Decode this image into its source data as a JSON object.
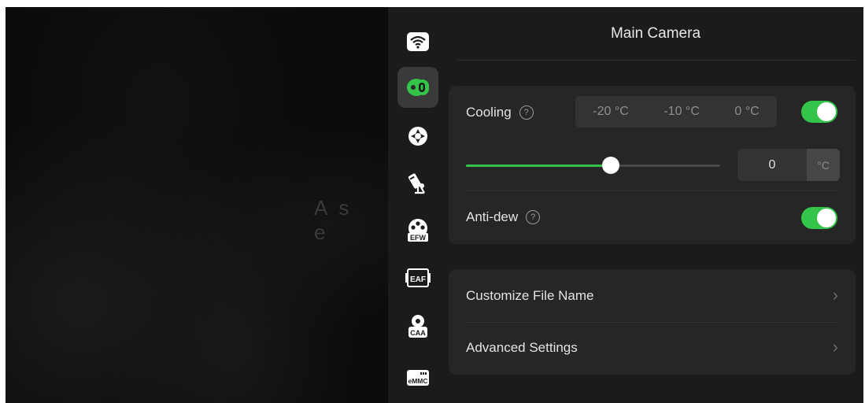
{
  "background": {
    "text": "As  e"
  },
  "panel": {
    "title": "Main Camera"
  },
  "sidebar": {
    "items": [
      {
        "icon": "wifi-icon",
        "label": "Wi-Fi"
      },
      {
        "icon": "main-camera-icon",
        "label": "Main Camera",
        "active": true
      },
      {
        "icon": "mount-icon",
        "label": "Mount"
      },
      {
        "icon": "guide-scope-icon",
        "label": "Guide"
      },
      {
        "icon": "efw-icon",
        "label": "EFW"
      },
      {
        "icon": "eaf-icon",
        "label": "EAF"
      },
      {
        "icon": "caa-icon",
        "label": "CAA"
      },
      {
        "icon": "emmc-icon",
        "label": "eMMC"
      }
    ],
    "icon_texts": {
      "efw": "EFW",
      "eaf": "EAF",
      "caa": "CAA",
      "emmc": "eMMC"
    }
  },
  "cooling": {
    "label": "Cooling",
    "help": "?",
    "presets": [
      "-20 °C",
      "-10 °C",
      "0 °C"
    ],
    "enabled": true,
    "slider_level": 0.57,
    "target_value": "0",
    "unit": "°C"
  },
  "antidew": {
    "label": "Anti-dew",
    "help": "?",
    "enabled": true
  },
  "menu": {
    "customize_file_name": "Customize File Name",
    "advanced_settings": "Advanced Settings",
    "chevron": "›"
  },
  "colors": {
    "accent": "#34c44a",
    "panel": "#1b1b1b",
    "card": "#262626"
  }
}
